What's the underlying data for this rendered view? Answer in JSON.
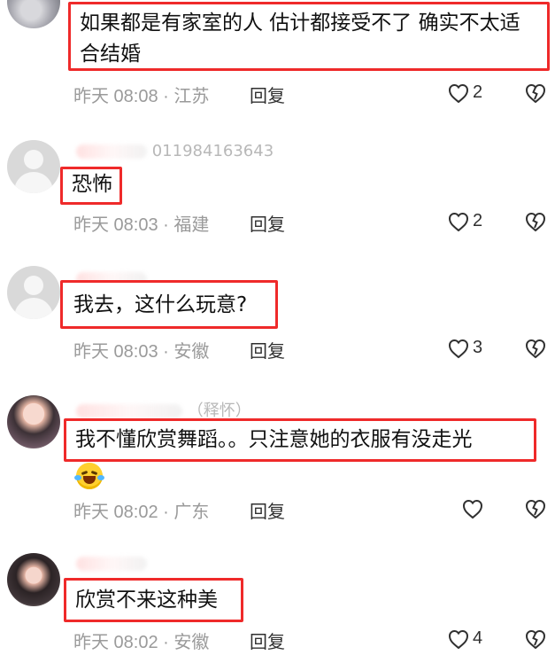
{
  "comments": [
    {
      "avatar_type": "partial",
      "username": "",
      "text": "如果都是有家室的人 估计都接受不了 确实不太适合结婚",
      "time_location": "昨天 08:08 · 江苏",
      "reply_label": "回复",
      "likes": "2",
      "like_icon": "heart-outline-icon",
      "dislike_icon": "broken-heart-icon"
    },
    {
      "avatar_type": "default",
      "username": "011984163643",
      "text": "恐怖",
      "time_location": "昨天 08:03 · 福建",
      "reply_label": "回复",
      "likes": "2",
      "like_icon": "heart-outline-icon",
      "dislike_icon": "broken-heart-icon"
    },
    {
      "avatar_type": "default",
      "username": "",
      "text": "我去，这什么玩意?",
      "time_location": "昨天 08:03 · 安徽",
      "reply_label": "回复",
      "likes": "3",
      "like_icon": "heart-outline-icon",
      "dislike_icon": "broken-heart-icon"
    },
    {
      "avatar_type": "photo",
      "username": "（释怀）",
      "text": "我不懂欣赏舞蹈。。只注意她的衣服有没走光",
      "emoji": "laughing-crying-emoji",
      "time_location": "昨天 08:02 · 广东",
      "reply_label": "回复",
      "likes": "",
      "like_icon": "heart-outline-icon",
      "dislike_icon": "broken-heart-icon"
    },
    {
      "avatar_type": "photo",
      "username": "",
      "text": "欣赏不来这种美",
      "time_location": "昨天 08:02 · 安徽",
      "reply_label": "回复",
      "likes": "4",
      "like_icon": "heart-outline-icon",
      "dislike_icon": "broken-heart-icon"
    }
  ],
  "colors": {
    "highlight_border": "#ef2a2a",
    "meta_text": "#9a9a9a",
    "primary_text": "#111111"
  }
}
